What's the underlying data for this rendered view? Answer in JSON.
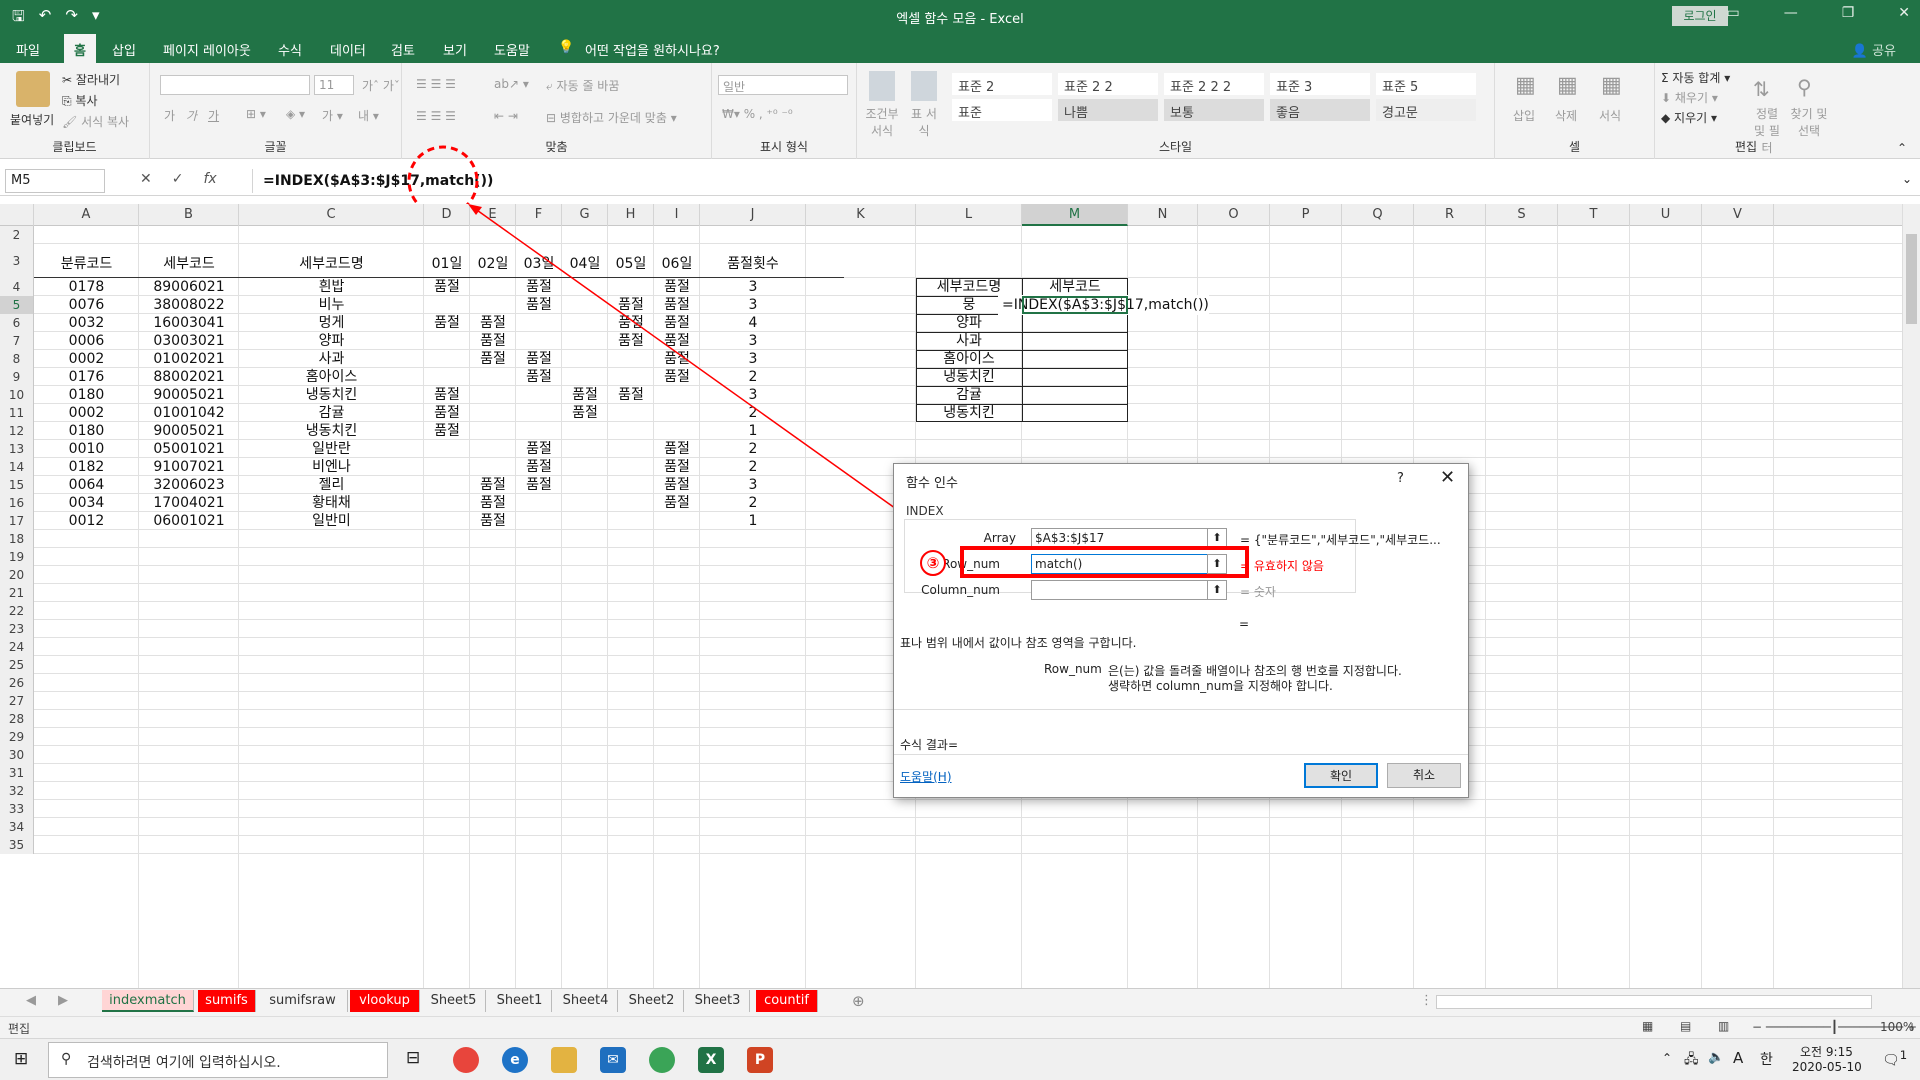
{
  "window": {
    "title": "엑셀 함수 모음  -  Excel",
    "login": "로그인"
  },
  "menu": {
    "items": [
      "파일",
      "홈",
      "삽입",
      "페이지 레이아웃",
      "수식",
      "데이터",
      "검토",
      "보기",
      "도움말"
    ],
    "tell_me": "어떤 작업을 원하시나요?",
    "share": "공유"
  },
  "ribbon": {
    "clipboard": {
      "paste": "붙여넣기",
      "cut": "잘라내기",
      "copy": "복사",
      "format_painter": "서식 복사",
      "label": "클립보드"
    },
    "font": {
      "size": "11",
      "label": "글꼴",
      "bold": "가",
      "italic": "가",
      "underline": "가"
    },
    "align": {
      "wrap": "자동 줄 바꿈",
      "merge": "병합하고 가운데 맞춤",
      "label": "맞춤"
    },
    "number": {
      "format": "일반",
      "label": "표시 형식"
    },
    "styles": {
      "cond": "조건부 서식",
      "table": "표 서식",
      "cells": [
        "표준 2",
        "표준 2 2",
        "표준 2 2 2",
        "표준 3",
        "표준 5",
        "표준",
        "나쁨",
        "보통",
        "좋음",
        "경고문"
      ],
      "label": "스타일"
    },
    "cells": {
      "insert": "삽입",
      "delete": "삭제",
      "format": "서식",
      "label": "셀"
    },
    "editing": {
      "autosum": "자동 합계",
      "fill": "채우기",
      "clear": "지우기",
      "sort": "정렬 및 필터",
      "find": "찾기 및 선택",
      "label": "편집"
    }
  },
  "formula_bar": {
    "name_box": "M5",
    "formula": "=INDEX($A$3:$J$17,match())",
    "fx": "fx"
  },
  "grid": {
    "columns": [
      "A",
      "B",
      "C",
      "D",
      "E",
      "F",
      "G",
      "H",
      "I",
      "J",
      "K",
      "L",
      "M",
      "N",
      "O",
      "P",
      "Q",
      "R",
      "S",
      "T",
      "U",
      "V"
    ],
    "rows": [
      "2",
      "3",
      "4",
      "5",
      "6",
      "7",
      "8",
      "9",
      "10",
      "11",
      "12",
      "13",
      "14",
      "15",
      "16",
      "17",
      "18",
      "19",
      "20",
      "21",
      "22",
      "23",
      "24",
      "25",
      "26",
      "27",
      "28",
      "29",
      "30",
      "31",
      "32",
      "33",
      "34",
      "35"
    ],
    "headers": [
      "분류코드",
      "세부코드",
      "세부코드명",
      "01일",
      "02일",
      "03일",
      "04일",
      "05일",
      "06일",
      "품절횟수"
    ],
    "data": [
      [
        "0178",
        "89006021",
        "흰밥",
        "품절",
        "",
        "품절",
        "",
        "",
        "품절",
        "3"
      ],
      [
        "0076",
        "38008022",
        "비누",
        "",
        "",
        "품절",
        "",
        "품절",
        "품절",
        "3"
      ],
      [
        "0032",
        "16003041",
        "멍게",
        "품절",
        "품절",
        "",
        "",
        "품절",
        "품절",
        "4"
      ],
      [
        "0006",
        "03003021",
        "양파",
        "",
        "품절",
        "",
        "",
        "품절",
        "품절",
        "3"
      ],
      [
        "0002",
        "01002021",
        "사과",
        "",
        "품절",
        "품절",
        "",
        "",
        "품절",
        "3"
      ],
      [
        "0176",
        "88002021",
        "홈아이스",
        "",
        "",
        "품절",
        "",
        "",
        "품절",
        "2"
      ],
      [
        "0180",
        "90005021",
        "냉동치킨",
        "품절",
        "",
        "",
        "품절",
        "품절",
        "",
        "3"
      ],
      [
        "0002",
        "01001042",
        "감귤",
        "품절",
        "",
        "",
        "품절",
        "",
        "",
        "2"
      ],
      [
        "0180",
        "90005021",
        "냉동치킨",
        "품절",
        "",
        "",
        "",
        "",
        "",
        "1"
      ],
      [
        "0010",
        "05001021",
        "일반란",
        "",
        "",
        "품절",
        "",
        "",
        "품절",
        "2"
      ],
      [
        "0182",
        "91007021",
        "비엔나",
        "",
        "",
        "품절",
        "",
        "",
        "품절",
        "2"
      ],
      [
        "0064",
        "32006023",
        "젤리",
        "",
        "품절",
        "품절",
        "",
        "",
        "품절",
        "3"
      ],
      [
        "0034",
        "17004021",
        "황태채",
        "",
        "품절",
        "",
        "",
        "",
        "품절",
        "2"
      ],
      [
        "0012",
        "06001021",
        "일반미",
        "",
        "품절",
        "",
        "",
        "",
        "",
        "1"
      ]
    ],
    "lookup_headers": [
      "세부코드명",
      "세부코드"
    ],
    "lookup_names": [
      "뭉",
      "양파",
      "사과",
      "홈아이스",
      "냉동치킨",
      "감귤",
      "냉동치킨"
    ],
    "editing_cell": "=INDEX($A$3:$J$17,match())"
  },
  "dialog": {
    "title": "함수 인수",
    "help_q": "?",
    "close": "✕",
    "function": "INDEX",
    "args": [
      {
        "label": "Array",
        "value": "$A$3:$J$17",
        "result": "= {\"분류코드\",\"세부코드\",\"세부코드..."
      },
      {
        "label": "Row_num",
        "value": "match()",
        "result": "= 유효하지 않음"
      },
      {
        "label": "Column_num",
        "value": "",
        "result": "= 숫자"
      }
    ],
    "equals": "=",
    "description": "표나 범위 내에서 값이나 참조 영역을 구합니다.",
    "arg_name": "Row_num",
    "arg_desc1": "은(는) 값을 돌려줄 배열이나 참조의 행 번호를 지정합니다.",
    "arg_desc2": "생략하면 column_num을 지정해야 합니다.",
    "result_label": "수식 결과=",
    "help_link": "도움말(H)",
    "ok": "확인",
    "cancel": "취소",
    "step_marker": "③"
  },
  "tabs": [
    "indexmatch",
    "sumifs",
    "sumifsraw",
    "vlookup",
    "Sheet5",
    "Sheet1",
    "Sheet4",
    "Sheet2",
    "Sheet3",
    "countif"
  ],
  "status": {
    "mode": "편집",
    "zoom": "100%"
  },
  "taskbar": {
    "search": "검색하려면 여기에 입력하십시오.",
    "time": "오전 9:15",
    "date": "2020-05-10",
    "ime": "한",
    "lang": "A",
    "notif": "1"
  },
  "colors": {
    "excel_green": "#217346",
    "highlight_red": "#ff0000",
    "tab_red": "#ff0000"
  }
}
